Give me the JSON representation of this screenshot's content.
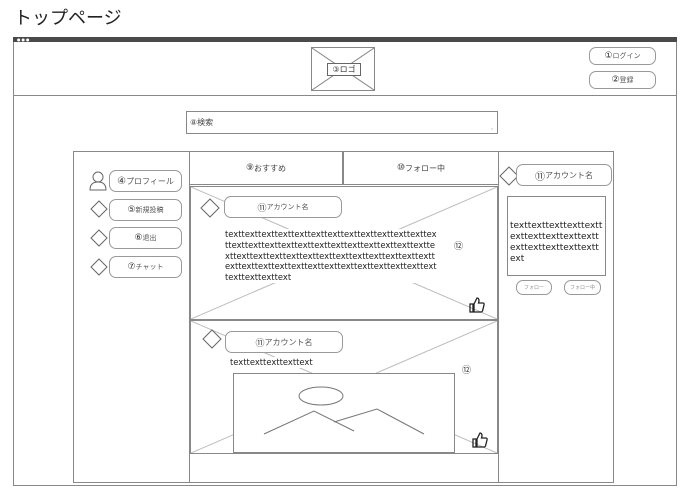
{
  "page": {
    "title": "トップページ"
  },
  "header": {
    "logo_label": "③ロゴ",
    "login": {
      "num": "①",
      "label": "ログイン"
    },
    "signup": {
      "num": "②",
      "label": "登録"
    }
  },
  "search": {
    "num": "⑧",
    "placeholder": "検索"
  },
  "sidebar": {
    "profile": {
      "num": "④",
      "label": "プロフィール"
    },
    "new_post": {
      "num": "⑤",
      "label": "新規投稿"
    },
    "logout": {
      "num": "⑥",
      "label": "退出"
    },
    "chat": {
      "num": "⑦",
      "label": "チャット"
    }
  },
  "tabs": {
    "recommended": {
      "num": "⑨",
      "label": "おすすめ"
    },
    "following": {
      "num": "⑩",
      "label": "フォロー中"
    }
  },
  "posts": [
    {
      "account": {
        "num": "⑪",
        "label": "アカウント名"
      },
      "text": "texttexttexttexttexttexttexttexttexttexttexttexttexttexttexttexttexttexttexttexttexttexttexttexttexttexttexttexttexttexttexttexttexttexttexttexttexttexttexttexttexttexttexttexttexttexttexttexttexttexttexttexttexttexttext",
      "badge": "⑫"
    },
    {
      "account": {
        "num": "⑪",
        "label": "アカウント名"
      },
      "text": "texttexttexttexttext",
      "badge": "⑫"
    }
  ],
  "right_panel": {
    "account": {
      "num": "⑪",
      "label": "アカウント名"
    },
    "bio": "texttexttexttexttexttexttexttexttexttexttexttexttexttexttexttext",
    "follow_button": "フォロー",
    "follow_status": "フォロー中"
  }
}
